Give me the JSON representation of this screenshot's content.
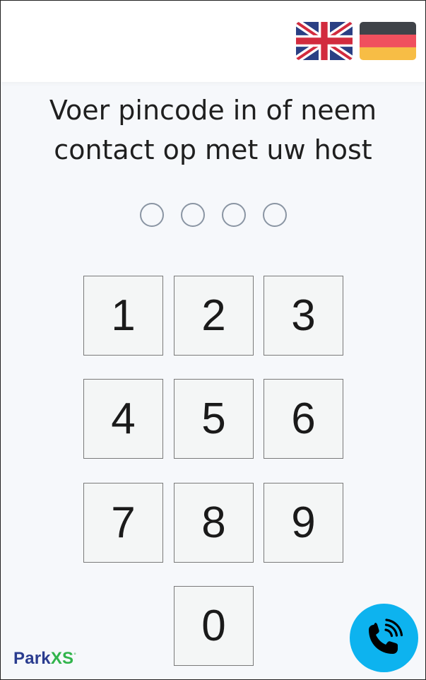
{
  "header": {
    "languages": [
      {
        "code": "en",
        "name": "English",
        "icon": "uk-flag-icon"
      },
      {
        "code": "de",
        "name": "Deutsch",
        "icon": "germany-flag-icon"
      }
    ]
  },
  "instruction": {
    "line1": "Voer pincode in of neem",
    "line2": "contact op met uw host"
  },
  "pin": {
    "length": 4,
    "entered": 0
  },
  "keypad": {
    "keys": [
      "1",
      "2",
      "3",
      "4",
      "5",
      "6",
      "7",
      "8",
      "9",
      "0"
    ]
  },
  "footer": {
    "logo_part1": "Park",
    "logo_part2": "XS",
    "logo_mark": "°",
    "call_icon": "phone-ringing-icon"
  },
  "colors": {
    "background": "#f6f8fb",
    "key_background": "#f4f6f6",
    "call_button": "#0db3ef",
    "logo_blue": "#2a3c8f",
    "logo_green": "#31b44b"
  }
}
